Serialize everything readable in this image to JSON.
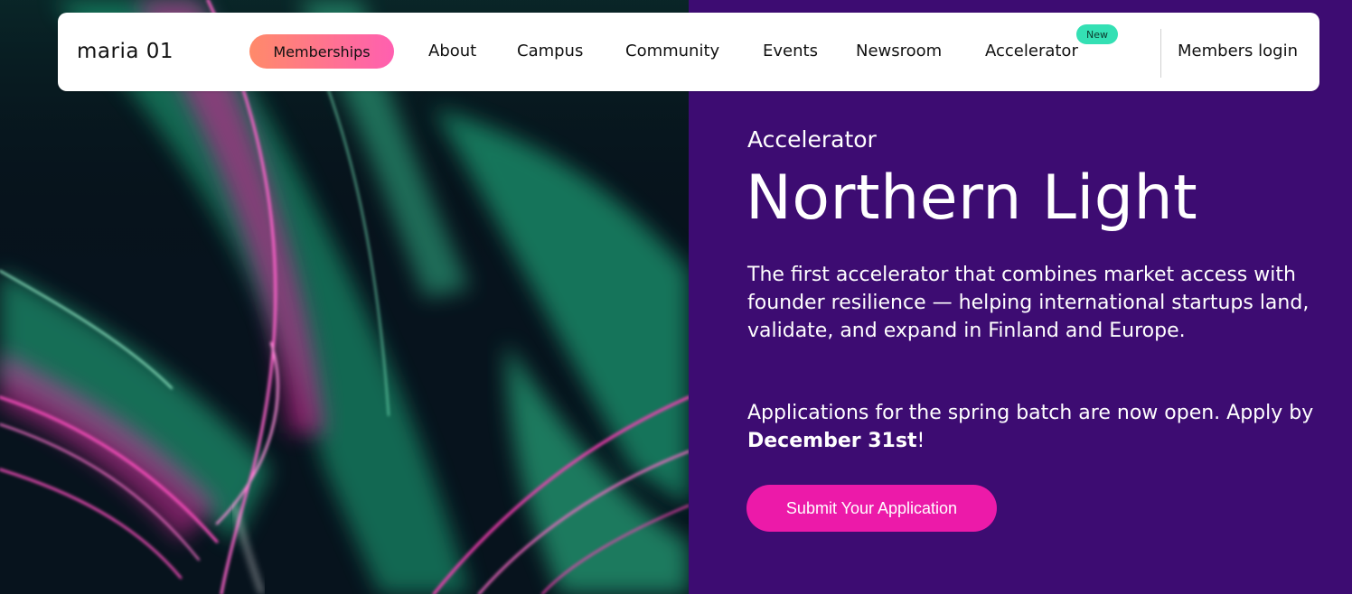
{
  "nav": {
    "logo": "maria 01",
    "items": [
      {
        "label": "Memberships"
      },
      {
        "label": "About"
      },
      {
        "label": "Campus"
      },
      {
        "label": "Community"
      },
      {
        "label": "Events"
      },
      {
        "label": "Newsroom"
      },
      {
        "label": "Accelerator",
        "badge": "New"
      }
    ],
    "login": "Members login"
  },
  "hero": {
    "image": "aurora-borealis-image",
    "eyebrow": "Accelerator",
    "title": "Northern Light",
    "description": "The first accelerator that combines market access with founder resilience — helping international startups land, validate, and expand in Finland and Europe.",
    "deadline_prefix": "Applications for the spring batch are now open. Apply by ",
    "deadline_date": "December 31st",
    "deadline_suffix": "!",
    "cta_label": "Submit Your Application"
  },
  "colors": {
    "panel_bg": "#3d0c72",
    "cta_bg": "#ec1aa9",
    "pill_gradient_start": "#ff8a6a",
    "pill_gradient_end": "#ff5fb0",
    "badge_bg": "#34e0b4"
  }
}
